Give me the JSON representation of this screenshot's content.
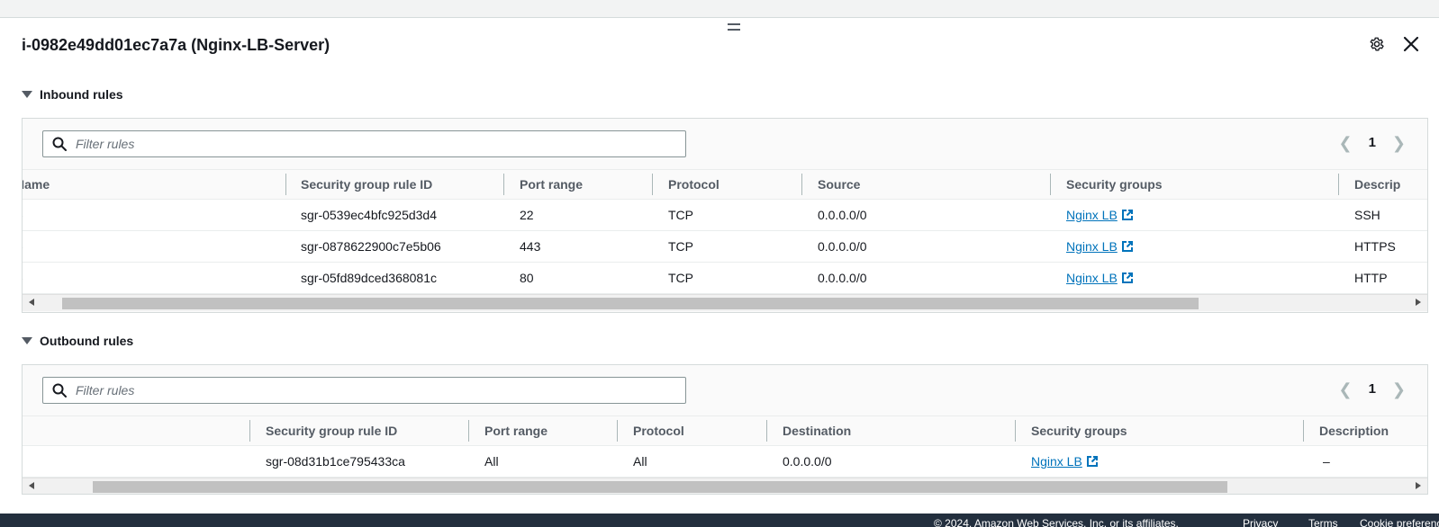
{
  "panel": {
    "title": "i-0982e49dd01ec7a7a (Nginx-LB-Server)",
    "settings_icon": "gear-icon",
    "close_icon": "close-icon"
  },
  "inbound": {
    "heading": "Inbound rules",
    "filter_placeholder": "Filter rules",
    "page": "1",
    "columns": [
      "Name",
      "Security group rule ID",
      "Port range",
      "Protocol",
      "Source",
      "Security groups",
      "Descrip"
    ],
    "rows": [
      {
        "name": "-",
        "rule_id": "sgr-0539ec4bfc925d3d4",
        "port": "22",
        "protocol": "TCP",
        "source": "0.0.0.0/0",
        "sg": "Nginx LB",
        "desc": "SSH"
      },
      {
        "name": "-",
        "rule_id": "sgr-0878622900c7e5b06",
        "port": "443",
        "protocol": "TCP",
        "source": "0.0.0.0/0",
        "sg": "Nginx LB",
        "desc": "HTTPS"
      },
      {
        "name": "-",
        "rule_id": "sgr-05fd89dced368081c",
        "port": "80",
        "protocol": "TCP",
        "source": "0.0.0.0/0",
        "sg": "Nginx LB",
        "desc": "HTTP"
      }
    ]
  },
  "outbound": {
    "heading": "Outbound rules",
    "filter_placeholder": "Filter rules",
    "page": "1",
    "columns": [
      "Security group rule ID",
      "Port range",
      "Protocol",
      "Destination",
      "Security groups",
      "Description"
    ],
    "rows": [
      {
        "rule_id": "sgr-08d31b1ce795433ca",
        "port": "All",
        "protocol": "All",
        "destination": "0.0.0.0/0",
        "sg": "Nginx LB",
        "desc": "–"
      }
    ]
  },
  "footer": {
    "copyright": "© 2024, Amazon Web Services, Inc. or its affiliates.",
    "privacy": "Privacy",
    "terms": "Terms",
    "cookies": "Cookie preferences"
  },
  "colors": {
    "link": "#0073bb",
    "footer_bg": "#232f3e",
    "header_text": "#545b64"
  }
}
